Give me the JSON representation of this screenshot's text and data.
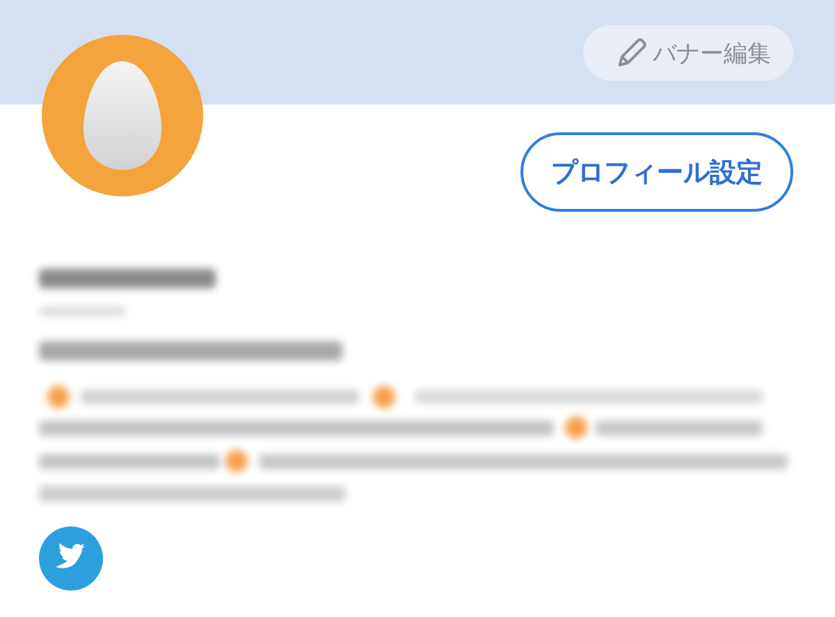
{
  "banner": {
    "edit_button": "バナー編集"
  },
  "profile": {
    "settings_button": "プロフィール設定"
  }
}
